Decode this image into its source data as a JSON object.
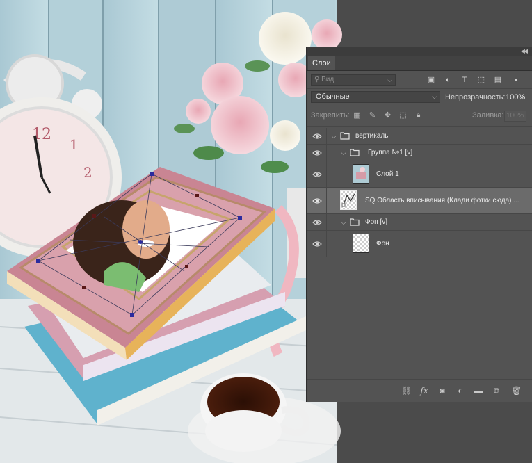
{
  "panel": {
    "tab_label": "Слои",
    "collapse_icon": "double-chevron-icon",
    "filter": {
      "placeholder": "Вид",
      "icons": [
        "image-filter-icon",
        "adjustment-filter-icon",
        "type-filter-icon",
        "shape-filter-icon",
        "smart-object-filter-icon",
        "filter-toggle-icon"
      ]
    },
    "blend_mode": "Обычные",
    "opacity_label": "Непрозрачность:",
    "opacity_value": "100%",
    "lock_label": "Закрепить:",
    "fill_label": "Заливка:",
    "fill_value": "100%",
    "layers": [
      {
        "name": "вертикаль",
        "type": "group",
        "visible": true
      },
      {
        "name": "Группа №1 [v]",
        "type": "group",
        "visible": true
      },
      {
        "name": "Слой 1",
        "type": "layer",
        "visible": true
      },
      {
        "name": "SQ Область вписывания (Клади фотки сюда) ...",
        "type": "smart-layer",
        "visible": true,
        "selected": true
      },
      {
        "name": "Фон [v]",
        "type": "group",
        "visible": true
      },
      {
        "name": "Фон",
        "type": "layer",
        "visible": true
      }
    ],
    "bottom_icons": [
      "link-layers-icon",
      "fx-icon",
      "mask-icon",
      "adjustment-layer-icon",
      "new-group-icon",
      "new-layer-icon",
      "trash-icon"
    ]
  },
  "colors": {
    "panel_bg": "#535353",
    "selected_row": "#6b6b6b",
    "transform_handle": "#2b2b9e"
  }
}
